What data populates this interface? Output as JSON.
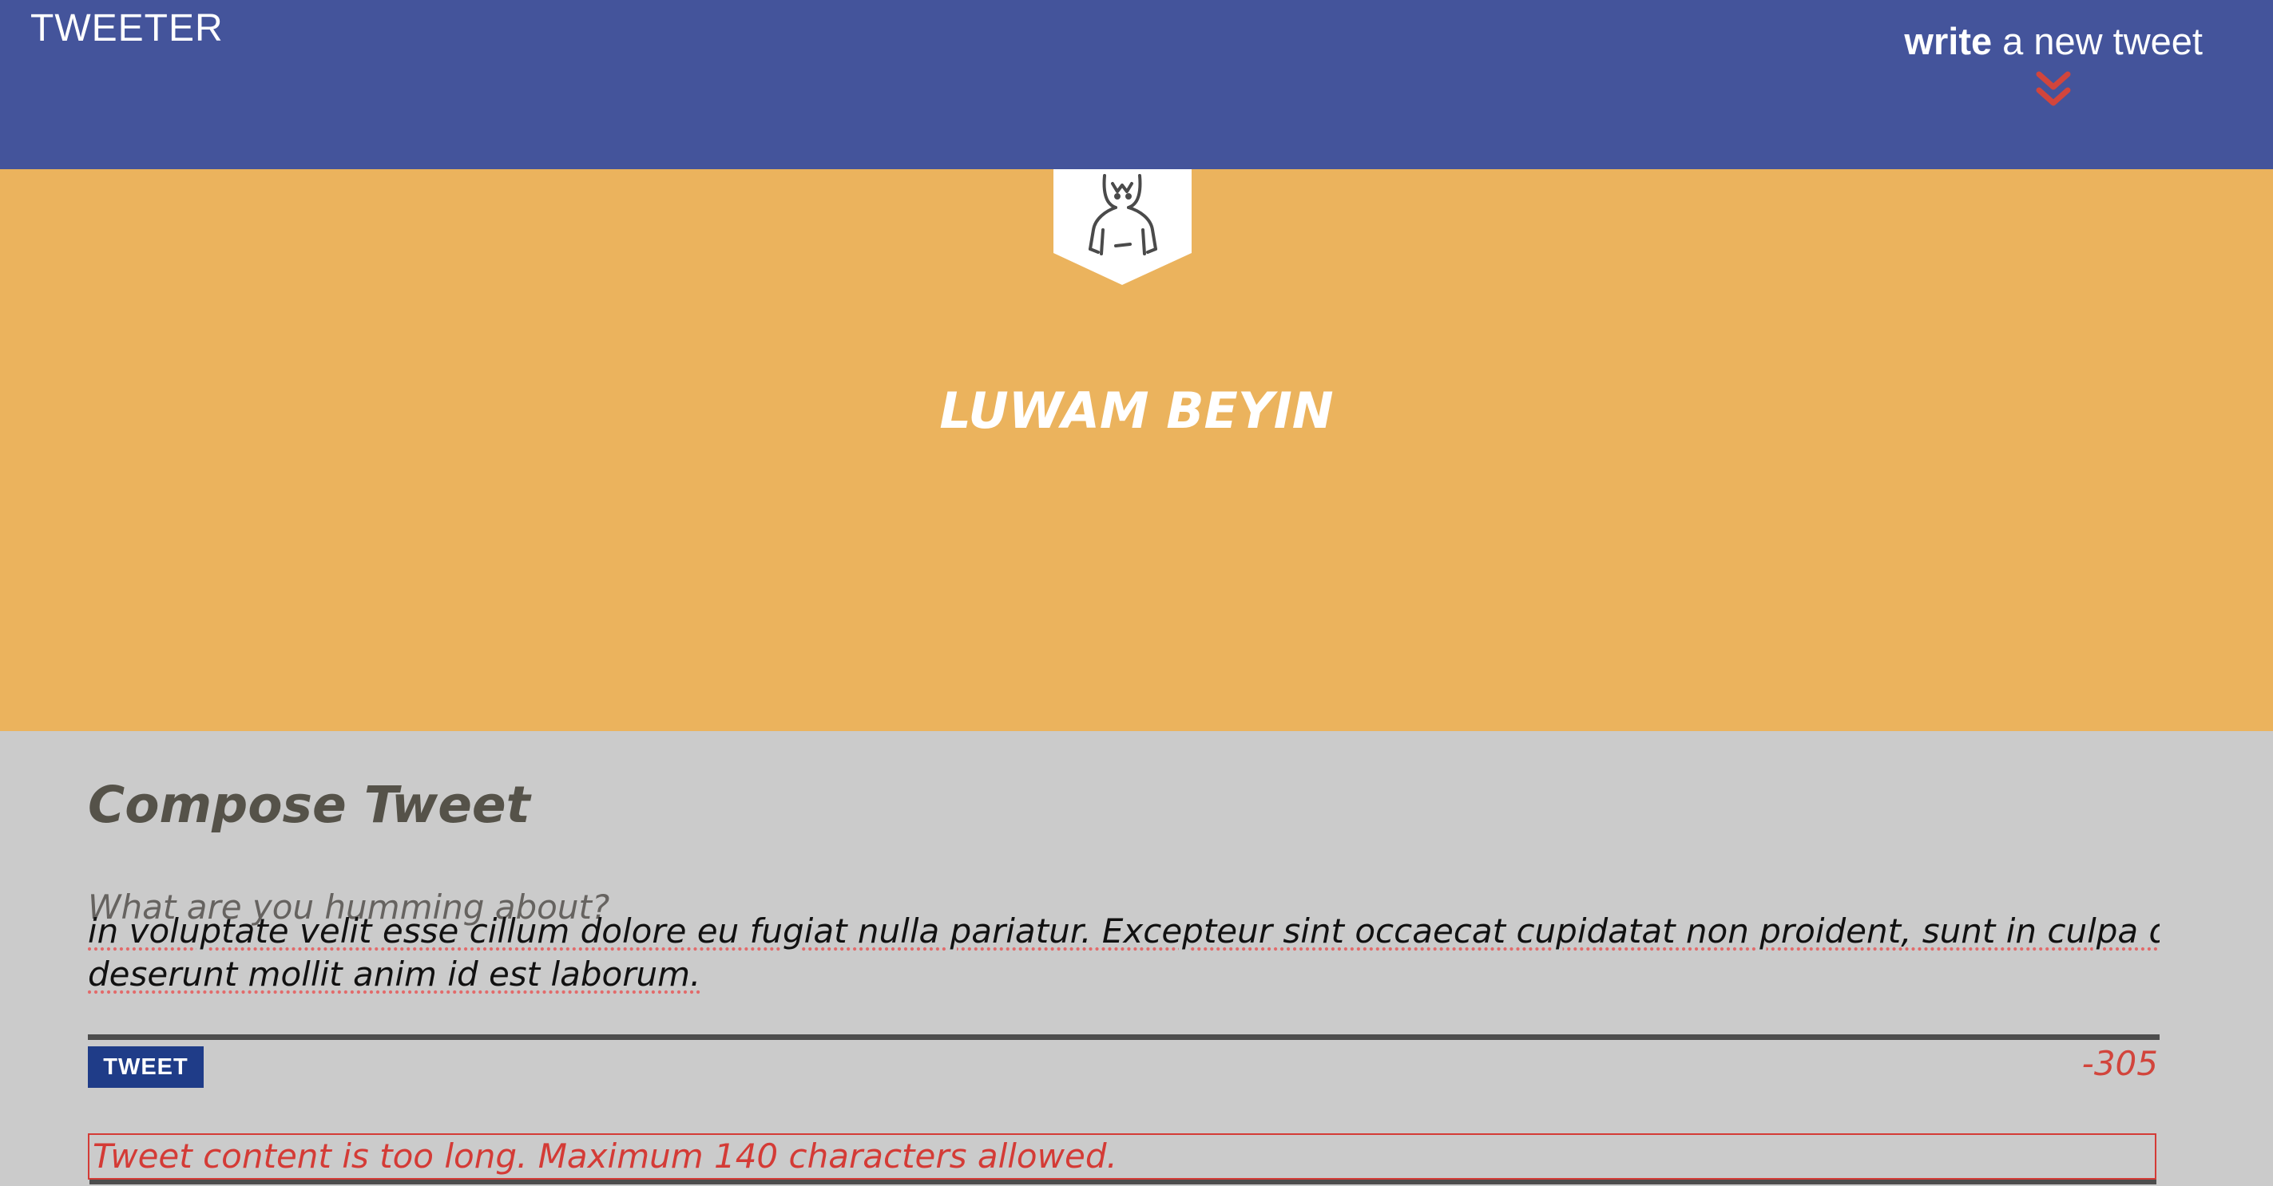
{
  "nav": {
    "brand": "TWEETER",
    "compose_toggle_bold": "write",
    "compose_toggle_rest": " a new tweet",
    "chevron_icon": "double-chevron-down-icon",
    "background": "#44549b",
    "chevron_color": "#d2453c"
  },
  "profile": {
    "username": "LUWAM BEYIN",
    "avatar_icon": "user-avatar-icon",
    "banner_color": "#ebb35d"
  },
  "compose": {
    "title": "Compose Tweet",
    "placeholder": "What are you humming about?",
    "text_line1": "in voluptate velit esse cillum dolore eu fugiat nulla pariatur. Excepteur sint occaecat cupidatat non proident, sunt in culpa qui officia",
    "text_line2": "deserunt mollit anim id est laborum.",
    "button_label": "TWEET",
    "char_counter": "-305",
    "error_message": "Tweet content is too long. Maximum 140 characters allowed.",
    "button_color": "#1f3c88",
    "error_color": "#d43b36"
  }
}
